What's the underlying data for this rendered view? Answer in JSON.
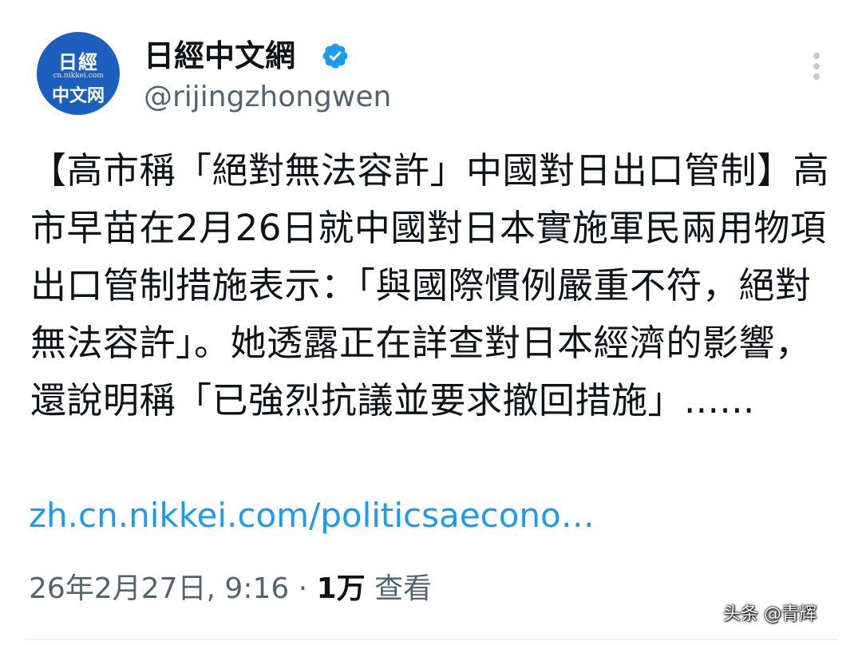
{
  "account": {
    "display_name": "日經中文網",
    "handle": "@rijingzhongwen",
    "verified": true,
    "avatar": {
      "logo_top": "日經",
      "logo_url": "cn.nikkei.com",
      "logo_bottom": "中文网",
      "background": "#1d5fbf"
    }
  },
  "tweet": {
    "text": "【高市稱「絕對無法容許」中國對日出口管制】高市早苗在2月26日就中國對日本實施軍民兩用物項出口管制措施表示：「與國際慣例嚴重不符，絕對無法容許」。她透露正在詳查對日本經濟的影響，還說明稱「已強烈抗議並要求撤回措施」......",
    "link": "zh.cn.nikkei.com/politicsaecono…",
    "timestamp": "26年2月27日, 9:16",
    "separator": "·",
    "views_count": "1万",
    "views_label": "查看"
  },
  "watermark": "头条 @青辉",
  "icons": {
    "verified": "verified-badge-icon",
    "more": "more-options-icon"
  },
  "colors": {
    "link": "#1d9bf0",
    "verified": "#1d9bf0",
    "secondary_text": "#536471",
    "primary_text": "#0f1419"
  }
}
